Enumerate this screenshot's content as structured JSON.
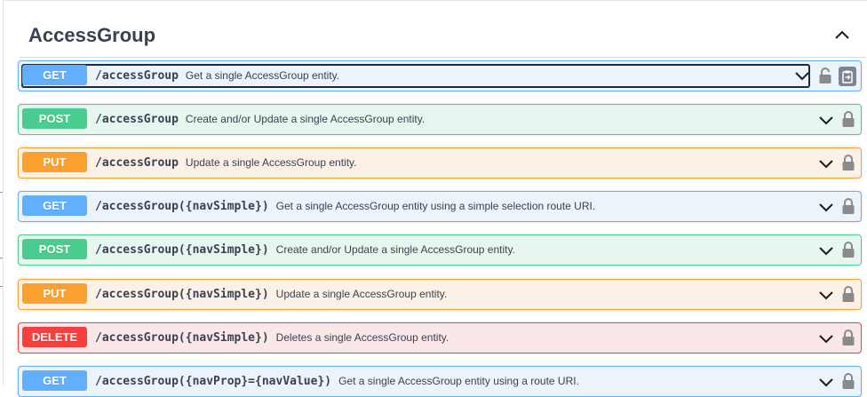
{
  "section": {
    "title": "AccessGroup",
    "collapse_icon": "chevron-up-icon"
  },
  "operations": [
    {
      "method": "GET",
      "path": "/accessGroup",
      "summary": "Get a single AccessGroup entity."
    },
    {
      "method": "POST",
      "path": "/accessGroup",
      "summary": "Create and/or Update a single AccessGroup entity."
    },
    {
      "method": "PUT",
      "path": "/accessGroup",
      "summary": "Update a single AccessGroup entity."
    },
    {
      "method": "GET",
      "path": "/accessGroup({navSimple})",
      "summary": "Get a single AccessGroup entity using a simple selection route URI."
    },
    {
      "method": "POST",
      "path": "/accessGroup({navSimple})",
      "summary": "Create and/or Update a single AccessGroup entity."
    },
    {
      "method": "PUT",
      "path": "/accessGroup({navSimple})",
      "summary": "Update a single AccessGroup entity."
    },
    {
      "method": "DELETE",
      "path": "/accessGroup({navSimple})",
      "summary": "Deletes a single AccessGroup entity."
    },
    {
      "method": "GET",
      "path": "/accessGroup({navProp}={navValue})",
      "summary": "Get a single AccessGroup entity using a route URI."
    }
  ],
  "colors": {
    "get": "#61affe",
    "post": "#49cc90",
    "put": "#fca130",
    "delete": "#f93e3e",
    "text": "#3b4151"
  },
  "icons": {
    "expand": "chevron-down-icon",
    "auth": "lock-icon",
    "copy": "copy-to-clipboard-icon"
  }
}
